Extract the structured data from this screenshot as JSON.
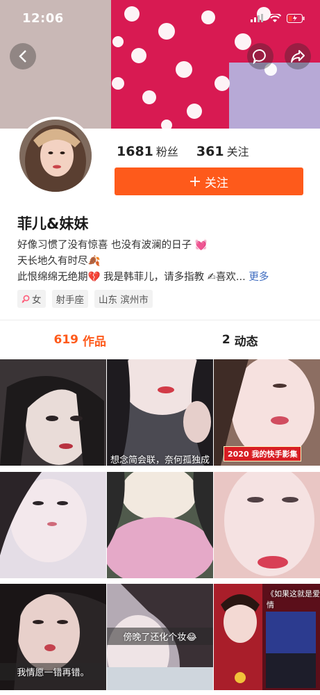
{
  "status_bar": {
    "time": "12:06"
  },
  "profile": {
    "fans_count": "1681",
    "fans_label": "粉丝",
    "following_count": "361",
    "following_label": "关注",
    "follow_button": "关注",
    "name": "菲儿&妹妹",
    "bio_line1": "好像习惯了没有惊喜 也没有波澜的日子",
    "bio_line1_emoji": "💓",
    "bio_line2": "天长地久有时尽",
    "bio_line2_emoji": "🍂",
    "bio_line3_a": "此恨绵绵无绝期",
    "bio_line3_emoji1": "💔",
    "bio_line3_b": "我是韩菲儿，请多指教",
    "bio_line3_emoji2": "✍",
    "bio_line3_c": "喜欢...",
    "bio_more": "更多",
    "tags": [
      "女",
      "射手座",
      "山东 滨州市"
    ],
    "accent_color": "#fe5a1b"
  },
  "tabs": [
    {
      "count": "619",
      "label": "作品"
    },
    {
      "count": "2",
      "label": "动态"
    }
  ],
  "videos": [
    {
      "caption": ""
    },
    {
      "caption": "想念简会联，奈何孤独成"
    },
    {
      "caption": "",
      "badge": "2020 我的快手影集"
    },
    {
      "caption": ""
    },
    {
      "caption": ""
    },
    {
      "caption": ""
    },
    {
      "caption": "我情愿一错再错。"
    },
    {
      "caption": "傍晚了还化个妆😂"
    },
    {
      "caption": "《如果这就是爱情"
    }
  ]
}
